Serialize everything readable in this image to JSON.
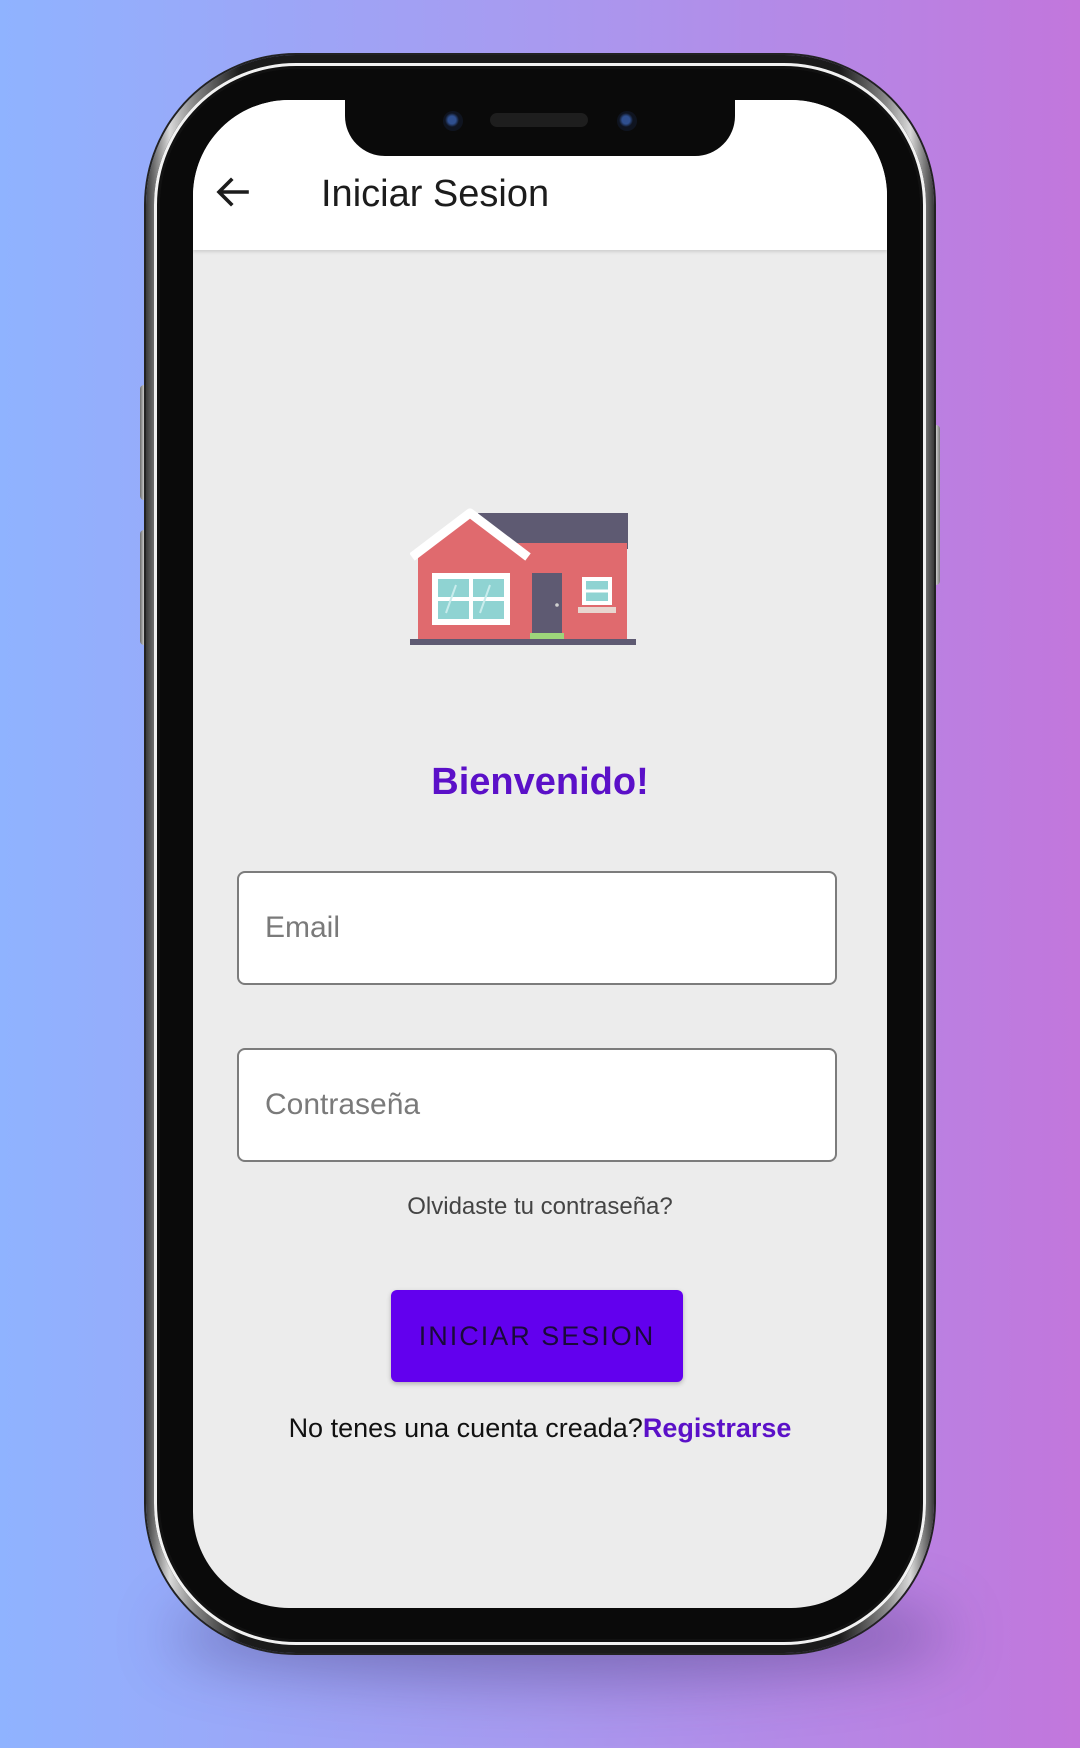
{
  "app": {
    "title": "Iniciar Sesion"
  },
  "login": {
    "welcome": "Bienvenido!",
    "email_placeholder": "Email",
    "password_placeholder": "Contraseña",
    "forgot_password": "Olvidaste tu contraseña?",
    "submit_label": "INICIAR SESION",
    "no_account_text": "No tenes una cuenta creada?",
    "register_label": "Registrarse"
  },
  "colors": {
    "accent": "#6200ee",
    "accent_text": "#5b10c8",
    "screen_background": "#ececec",
    "appbar_background": "#ffffff"
  },
  "icons": {
    "back": "arrow-back-icon",
    "logo": "house-icon"
  }
}
